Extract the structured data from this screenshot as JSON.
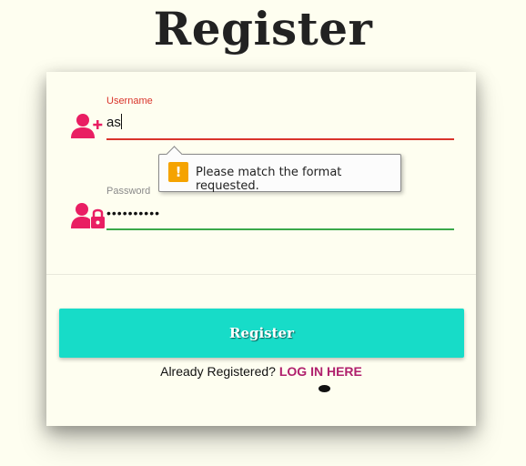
{
  "page": {
    "title": "Register"
  },
  "form": {
    "username": {
      "label": "Username",
      "value": "as"
    },
    "password": {
      "label": "Password",
      "masked_value": "••••••••••"
    },
    "submit_label": "Register",
    "login_prompt": "Already Registered?",
    "login_link": "LOG IN HERE"
  },
  "validation_tooltip": {
    "icon": "warning-icon",
    "icon_glyph": "!",
    "message": "Please match the format requested."
  },
  "colors": {
    "accent": "#e91e63",
    "error": "#d9342b",
    "valid": "#3aa84a",
    "button": "#17dcc8",
    "link": "#b0206d"
  }
}
